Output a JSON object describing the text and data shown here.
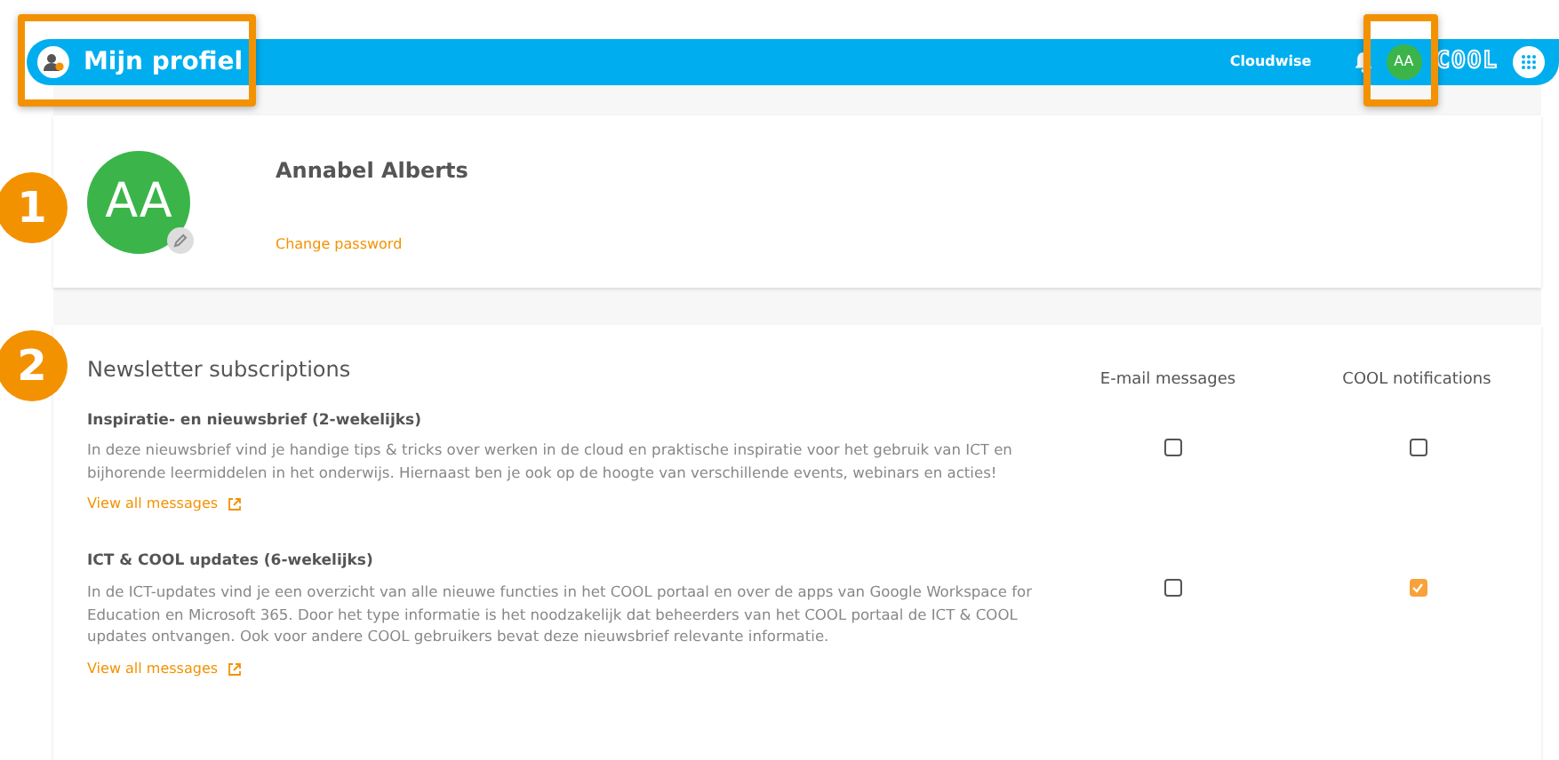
{
  "header": {
    "title": "Mijn profiel",
    "organization": "Cloudwise",
    "avatar_initials": "AA",
    "logo": "COOL"
  },
  "profile": {
    "avatar_initials": "AA",
    "name": "Annabel Alberts",
    "change_password": "Change password"
  },
  "newsletters": {
    "title": "Newsletter subscriptions",
    "columns": [
      "E-mail messages",
      "COOL notifications"
    ],
    "items": [
      {
        "name": "Inspiratie- en nieuwsbrief (2-wekelijks)",
        "description": "In deze nieuwsbrief vind je handige tips & tricks over werken in de cloud en praktische inspiratie voor het gebruik van ICT en bijhorende leermiddelen in het onderwijs. Hiernaast ben je ook op de hoogte van verschillende events, webinars en acties!",
        "link": "View all messages",
        "email": false,
        "cool": false
      },
      {
        "name": "ICT & COOL updates (6-wekelijks)",
        "description": "In de ICT-updates vind je een overzicht van alle nieuwe functies in het COOL portaal en over de apps van Google Workspace for Education en Microsoft 365. Door het type informatie is het noodzakelijk dat beheerders van het COOL portaal de ICT & COOL updates ontvangen. Ook voor andere COOL gebruikers bevat deze nieuwsbrief relevante informatie.",
        "link": "View all messages",
        "email": false,
        "cool": true
      }
    ]
  },
  "callouts": [
    {
      "label": "1"
    },
    {
      "label": "2"
    }
  ]
}
